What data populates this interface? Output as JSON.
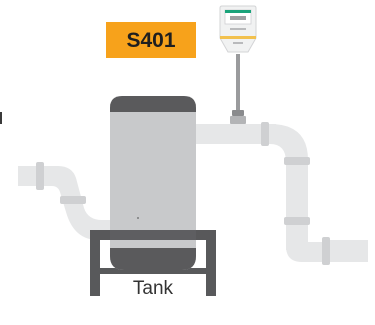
{
  "sensor_badge": {
    "label": "S401",
    "color": "#f7a21b",
    "text_color": "#1f1f1f"
  },
  "tank": {
    "caption": "Tank",
    "body_color": "#c8c9cb",
    "cap_color": "#5a5a5c"
  },
  "pipe": {
    "color": "#e6e7e8",
    "joint_color": "#cfd0d2"
  },
  "stand": {
    "color": "#58595b"
  },
  "sensor_device": {
    "body_color": "#f1f2f2",
    "screen_accent": "#1aa37a",
    "band_color": "#f2c14e"
  }
}
